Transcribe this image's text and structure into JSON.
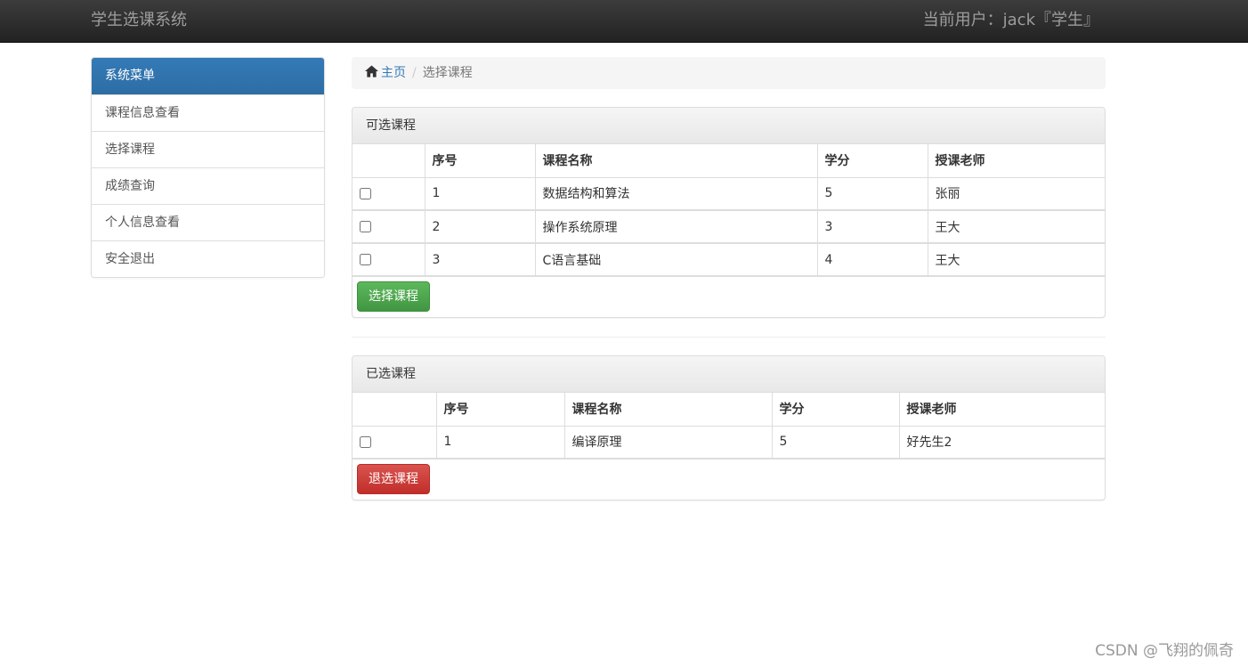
{
  "navbar": {
    "brand": "学生选课系统",
    "user_info": "当前用户：jack『学生』"
  },
  "sidebar": {
    "heading": "系统菜单",
    "items": [
      {
        "label": "课程信息查看"
      },
      {
        "label": "选择课程"
      },
      {
        "label": "成绩查询"
      },
      {
        "label": "个人信息查看"
      },
      {
        "label": "安全退出"
      }
    ]
  },
  "breadcrumb": {
    "home": "主页",
    "separator": "/",
    "current": "选择课程"
  },
  "available_panel": {
    "title": "可选课程",
    "headers": [
      "序号",
      "课程名称",
      "学分",
      "授课老师"
    ],
    "rows": [
      {
        "no": "1",
        "name": "数据结构和算法",
        "credit": "5",
        "teacher": "张丽"
      },
      {
        "no": "2",
        "name": "操作系统原理",
        "credit": "3",
        "teacher": "王大"
      },
      {
        "no": "3",
        "name": "C语言基础",
        "credit": "4",
        "teacher": "王大"
      }
    ],
    "button_label": "选择课程"
  },
  "selected_panel": {
    "title": "已选课程",
    "headers": [
      "序号",
      "课程名称",
      "学分",
      "授课老师"
    ],
    "rows": [
      {
        "no": "1",
        "name": "编译原理",
        "credit": "5",
        "teacher": "好先生2"
      }
    ],
    "button_label": "退选课程"
  },
  "watermark": "CSDN @飞翔的佩奇",
  "colors": {
    "primary": "#337ab7",
    "success": "#5cb85c",
    "danger": "#d9534f",
    "navbar": "#222222"
  }
}
